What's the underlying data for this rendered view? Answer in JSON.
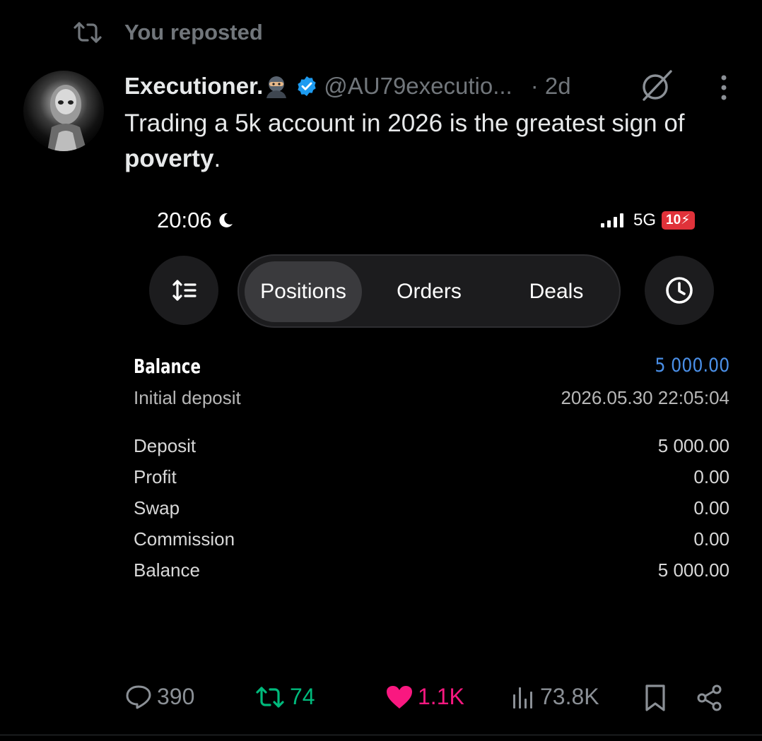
{
  "repost": {
    "text": "You reposted"
  },
  "author": {
    "name": "Executioner.",
    "handle": "@AU79executio...",
    "time": "· 2d"
  },
  "tweet": {
    "text_before": "Trading a 5k account in 2026 is the greatest sign of",
    "text_bold": "poverty",
    "text_after": "."
  },
  "screenshot": {
    "clock": "20:06",
    "network": "5G",
    "battery": "10",
    "tabs": [
      {
        "label": "Positions",
        "active": true
      },
      {
        "label": "Orders",
        "active": false
      },
      {
        "label": "Deals",
        "active": false
      }
    ],
    "balance_title": "Balance",
    "balance_value": "5 000.00",
    "initial_label": "Initial deposit",
    "initial_datetime": "2026.05.30 22:05:04",
    "rows": [
      {
        "label": "Deposit",
        "value": "5 000.00"
      },
      {
        "label": "Profit",
        "value": "0.00"
      },
      {
        "label": "Swap",
        "value": "0.00"
      },
      {
        "label": "Commission",
        "value": "0.00"
      },
      {
        "label": "Balance",
        "value": "5 000.00"
      }
    ]
  },
  "actions": {
    "replies": "390",
    "reposts": "74",
    "likes": "1.1K",
    "views": "73.8K"
  },
  "colors": {
    "background": "#000000",
    "text": "#e7e9ea",
    "muted": "#71767b",
    "verified": "#1d9bf0",
    "repost_green": "#00ba7c",
    "like_pink": "#f91880",
    "balance_blue": "#4a8fe7",
    "battery_red": "#e0323a"
  },
  "icons": [
    "repost-icon",
    "ninja-emoji-icon",
    "verified-badge-icon",
    "grok-icon",
    "more-icon",
    "moon-icon",
    "signal-icon",
    "sort-icon",
    "clock-icon",
    "reply-icon",
    "retweet-icon",
    "heart-icon",
    "views-icon",
    "bookmark-icon",
    "share-icon"
  ]
}
